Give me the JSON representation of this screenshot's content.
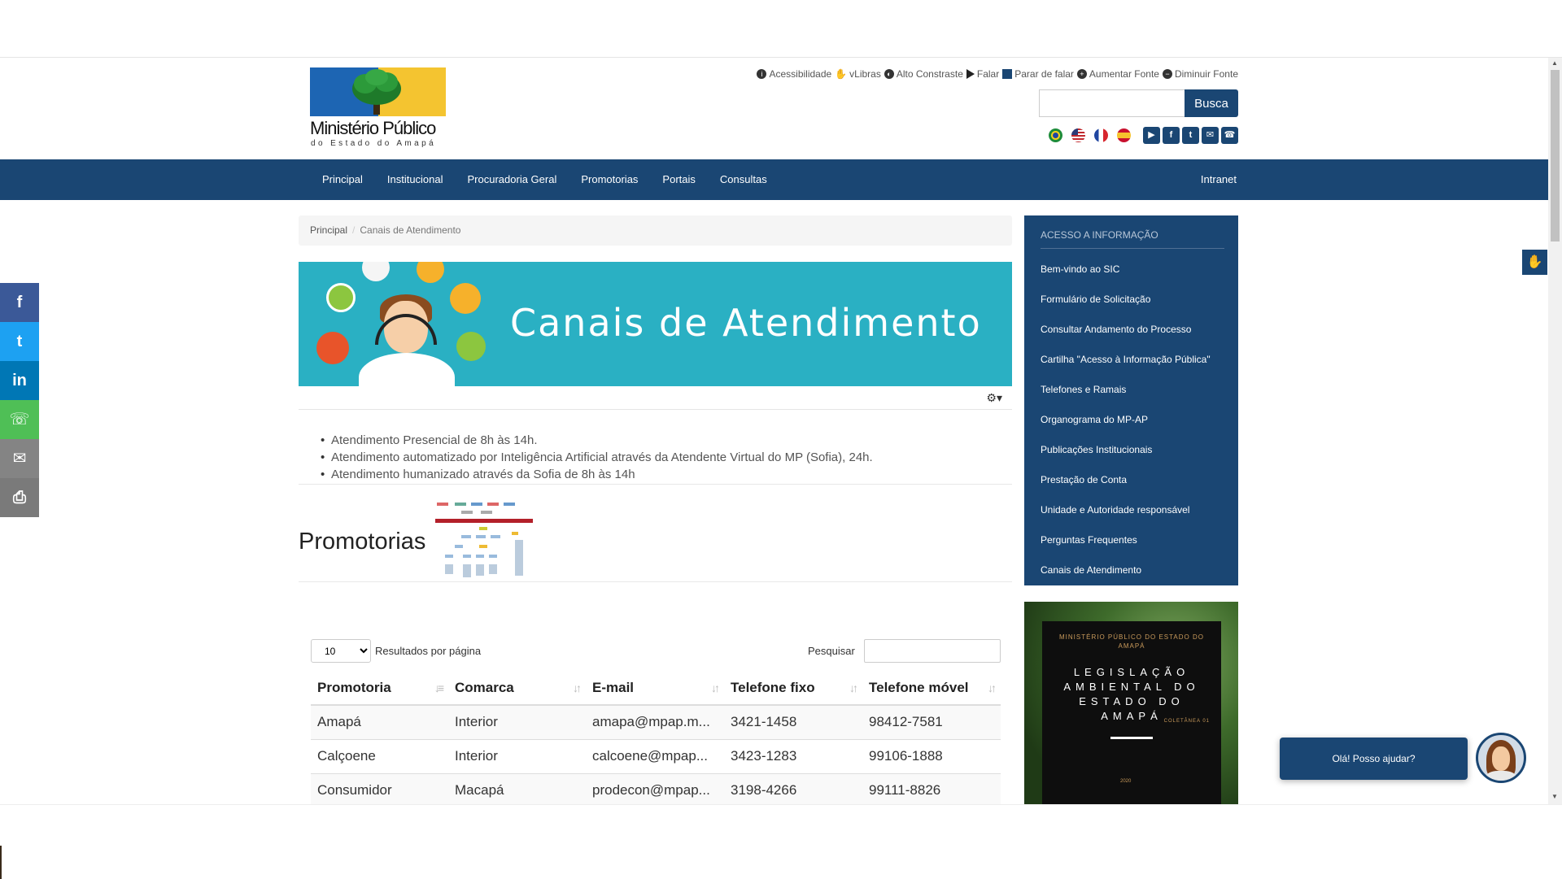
{
  "header": {
    "logo_name": "Ministério Público",
    "logo_sub": "do Estado do Amapá",
    "accessibility": [
      "Acessibilidade",
      "vLibras",
      "Alto Constraste",
      "Falar",
      "Parar de falar",
      "Aumentar Fonte",
      "Diminuir Fonte"
    ],
    "search_button": "Busca",
    "search_value": ""
  },
  "nav": {
    "items": [
      "Principal",
      "Institucional",
      "Procuradoria Geral",
      "Promotorias",
      "Portais",
      "Consultas"
    ],
    "intranet": "Intranet"
  },
  "breadcrumb": {
    "home": "Principal",
    "current": "Canais de Atendimento"
  },
  "banner": {
    "title": "Canais de Atendimento"
  },
  "content": {
    "list": [
      "Atendimento Presencial de 8h às 14h.",
      "Atendimento automatizado por Inteligência Artificial através da Atendente Virtual do MP (Sofia), 24h.",
      "Atendimento humanizado através da Sofia de 8h às 14h"
    ],
    "promo_heading": "Promotorias"
  },
  "table": {
    "page_size": "10",
    "page_size_label": "Resultados por página",
    "search_label": "Pesquisar",
    "search_value": "",
    "columns": [
      "Promotoria",
      "Comarca",
      "E-mail",
      "Telefone fixo",
      "Telefone móvel"
    ],
    "rows": [
      [
        "Amapá",
        "Interior",
        "amapa@mpap.m...",
        "3421-1458",
        "98412-7581"
      ],
      [
        "Calçoene",
        "Interior",
        "calcoene@mpap...",
        "3423-1283",
        "99106-1888"
      ],
      [
        "Consumidor",
        "Macapá",
        "prodecon@mpap...",
        "3198-4266",
        "99111-8826"
      ]
    ]
  },
  "sidebar": {
    "heading": "ACESSO A INFORMAÇÃO",
    "items": [
      "Bem-vindo ao SIC",
      "Formulário de Solicitação",
      "Consultar Andamento do Processo",
      "Cartilha \"Acesso à Informação Pública\"",
      "Telefones e Ramais",
      "Organograma do MP-AP",
      "Publicações Institucionais",
      "Prestação de Conta",
      "Unidade e Autoridade responsável",
      "Perguntas Frequentes",
      "Canais de Atendimento"
    ]
  },
  "legislacao": {
    "org": "MINISTÉRIO PÚBLICO DO ESTADO DO AMAPÁ",
    "title": "LEGISLAÇÃO AMBIENTAL DO ESTADO DO AMAPÁ",
    "collection": "COLETÂNEA 01",
    "year": "2020"
  },
  "chat": {
    "bubble": "Olá! Posso ajudar?"
  },
  "colors": {
    "primary": "#1a4673",
    "banner": "#2ab0c3"
  }
}
